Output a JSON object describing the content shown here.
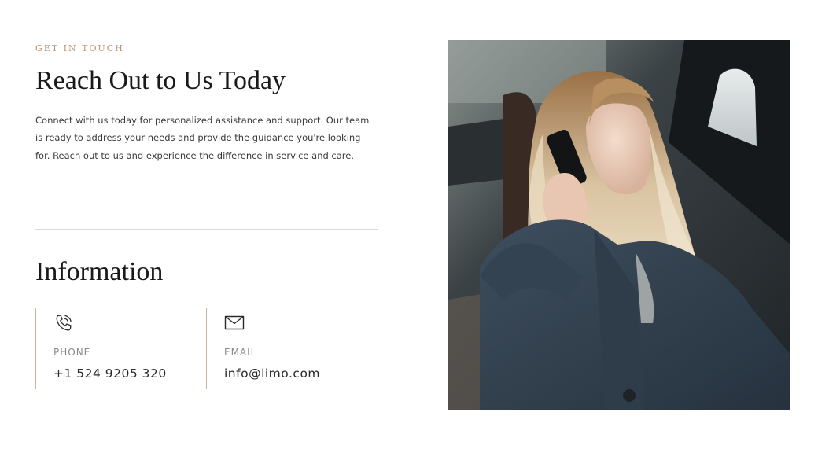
{
  "section": {
    "eyebrow": "GET IN TOUCH",
    "title": "Reach Out to Us Today",
    "description": "Connect with us today for personalized assistance and support. Our team is ready to address your needs and provide the guidance you're looking for. Reach out to us and experience the difference in service and care."
  },
  "information": {
    "title": "Information",
    "phone": {
      "icon": "phone-icon",
      "label": "PHONE",
      "value": "+1 524 9205 320"
    },
    "email": {
      "icon": "envelope-icon",
      "label": "EMAIL",
      "value": "info@limo.com"
    }
  },
  "image": {
    "subject": "photo-woman-on-phone"
  },
  "colors": {
    "accent": "#b8957c",
    "border_accent": "#c9b49c",
    "heading": "#1a1a1a",
    "body": "#3a3a3a",
    "divider": "#d9d9d9"
  }
}
